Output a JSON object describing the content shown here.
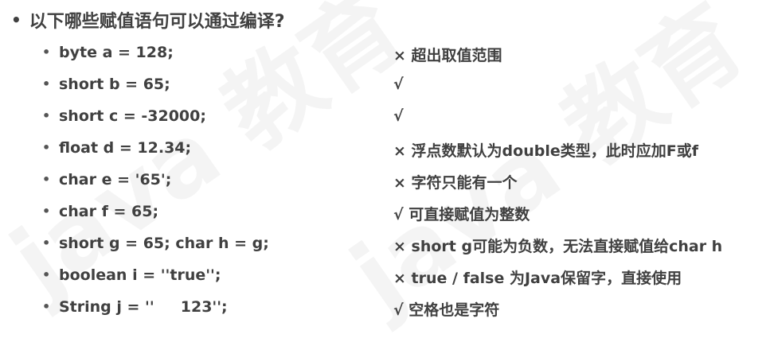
{
  "slide": {
    "title_bullet": "•",
    "title": "以下哪些赋值语句可以通过编译?",
    "watermark_text": "java 教育"
  },
  "rows": [
    {
      "bullet": "•",
      "code": "byte a = 128;",
      "result": "× 超出取值范围"
    },
    {
      "bullet": "•",
      "code": "short b = 65;",
      "result": "√"
    },
    {
      "bullet": "•",
      "code": "short c = -32000;",
      "result": "√"
    },
    {
      "bullet": "•",
      "code": "float d = 12.34;",
      "result": "× 浮点数默认为double类型，此时应加F或f"
    },
    {
      "bullet": "•",
      "code": "char e = '65';",
      "result": "× 字符只能有一个"
    },
    {
      "bullet": "•",
      "code": "char f = 65;",
      "result": "√ 可直接赋值为整数"
    },
    {
      "bullet": "•",
      "code": "short g = 65; char h = g;",
      "result": "× short g可能为负数，无法直接赋值给char h"
    },
    {
      "bullet": "•",
      "code": "boolean i = ''true'';",
      "result": "× true / false 为Java保留字，直接使用"
    },
    {
      "bullet": "•",
      "code": "String j = ''     123'';",
      "result": "√ 空格也是字符"
    }
  ]
}
